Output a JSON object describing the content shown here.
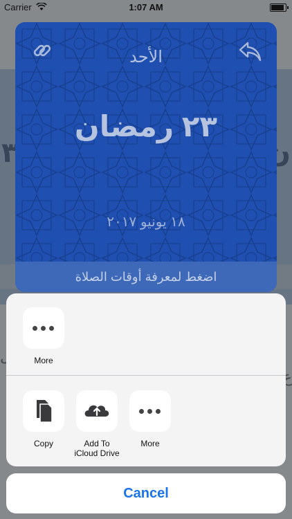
{
  "status_bar": {
    "carrier": "Carrier",
    "time": "1:07 AM"
  },
  "card": {
    "day_name": "الأحد",
    "hijri_date": "٢٣ رمضان",
    "gregorian_date": "١٨ يونيو ٢٠١٧",
    "prayer_prompt": "اضغط لمعرفة أوقات الصلاة",
    "color": "#1f4fb0"
  },
  "share_sheet": {
    "row1": [
      {
        "label": "More",
        "icon": "more-icon"
      }
    ],
    "row2": [
      {
        "label": "Copy",
        "icon": "copy-icon"
      },
      {
        "label": "Add To iCloud Drive",
        "icon": "icloud-upload-icon"
      },
      {
        "label": "More",
        "icon": "more-icon"
      }
    ],
    "cancel_label": "Cancel",
    "accent": "#1a73e8"
  }
}
